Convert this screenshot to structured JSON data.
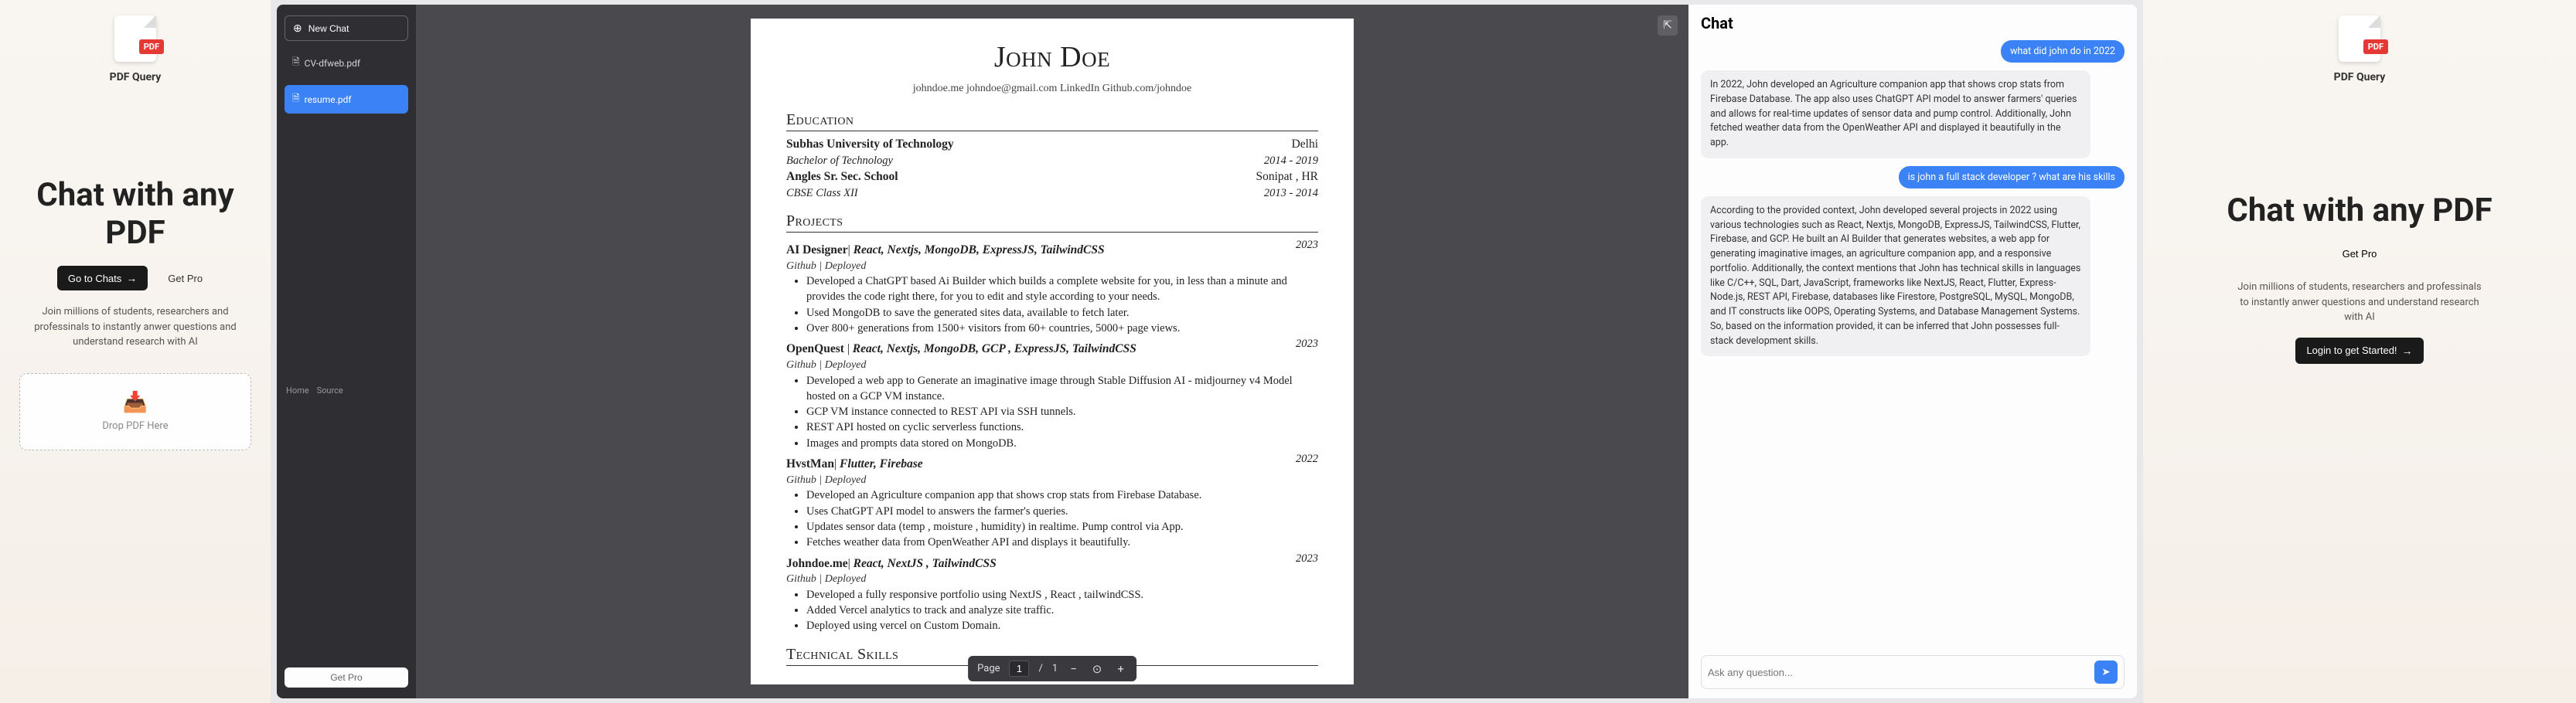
{
  "left": {
    "app_name": "PDF Query",
    "headline": "Chat with any PDF",
    "go_to_chats": "Go to Chats",
    "get_pro": "Get Pro",
    "subtext": "Join millions of students, researchers and professinals to instantly anwer questions and understand research with AI",
    "dropzone_text": "Drop PDF Here"
  },
  "app": {
    "sidebar": {
      "new_chat": "New Chat",
      "files": [
        "CV-dfweb.pdf",
        "resume.pdf"
      ],
      "get_pro": "Get Pro",
      "footer_home": "Home",
      "footer_source": "Source"
    },
    "resume": {
      "name": "John Doe",
      "contact": "johndoe.me johndoe@gmail.com LinkedIn Github.com/johndoe",
      "sections": {
        "education": "Education",
        "projects": "Projects",
        "technical": "Technical Skills"
      },
      "edu1": {
        "school": "Subhas University of Technology",
        "loc": "Delhi",
        "degree": "Bachelor of Technology",
        "dates": "2014 - 2019"
      },
      "edu2": {
        "school": "Angles Sr. Sec. School",
        "loc": "Sonipat , HR",
        "degree": "CBSE Class XII",
        "dates": "2013 - 2014"
      },
      "proj1": {
        "title": "AI Designer",
        "tech": "React, Nextjs, MongoDB, ExpressJS, TailwindCSS",
        "year": "2023",
        "sub": "Github | Deployed",
        "b1": "Developed a ChatGPT based Ai Builder which builds a complete website for you, in less than a minute and provides the code right there, for you to edit and style according to your needs.",
        "b2": "Used MongoDB to save the generated sites data, available to fetch later.",
        "b3": "Over 800+ generations from 1500+ visitors from 60+ countries, 5000+ page views."
      },
      "proj2": {
        "title": "OpenQuest",
        "tech": "React, Nextjs, MongoDB, GCP , ExpressJS, TailwindCSS",
        "year": "2023",
        "sub": "Github | Deployed",
        "b1": "Developed a web app to Generate an imaginative image through Stable Diffusion AI - midjourney v4 Model hosted on a GCP VM instance.",
        "b2": "GCP VM instance connected to REST API via SSH tunnels.",
        "b3": "REST API hosted on cyclic serverless functions.",
        "b4": "Images and prompts data stored on MongoDB."
      },
      "proj3": {
        "title": "HvstMan",
        "tech": "Flutter, Firebase",
        "year": "2022",
        "sub": "Github | Deployed",
        "b1": "Developed an Agriculture companion app that shows crop stats from Firebase Database.",
        "b2": "Uses ChatGPT API model to answers the farmer's queries.",
        "b3": "Updates sensor data (temp , moisture , humidity) in realtime. Pump control via App.",
        "b4": "Fetches weather data from OpenWeather API and displays it beautifully."
      },
      "proj4": {
        "title": "Johndoe.me",
        "tech": "React, NextJS , TailwindCSS",
        "year": "2023",
        "sub": "Github | Deployed",
        "b1": "Developed a fully responsive portfolio using NextJS , React , tailwindCSS.",
        "b2": "Added Vercel analytics to track and analyze site traffic.",
        "b3": "Deployed using vercel on Custom Domain."
      }
    },
    "pdf_toolbar": {
      "page_label": "Page",
      "page_current": "1",
      "page_total": "1"
    },
    "chat": {
      "title": "Chat",
      "q1": "what did john do in 2022",
      "a1": "In 2022, John developed an Agriculture companion app that shows crop stats from Firebase Database. The app also uses ChatGPT API model to answer farmers' queries and allows for real-time updates of sensor data and pump control. Additionally, John fetched weather data from the OpenWeather API and displayed it beautifully in the app.",
      "q2": "is john a full stack developer ? what are his skills",
      "a2": "According to the provided context, John developed several projects in 2022 using various technologies such as React, Nextjs, MongoDB, ExpressJS, TailwindCSS, Flutter, Firebase, and GCP. He built an AI Builder that generates websites, a web app for generating imaginative images, an agriculture companion app, and a responsive portfolio. Additionally, the context mentions that John has technical skills in languages like C/C++, SQL, Dart, JavaScript, frameworks like NextJS, React, Flutter, Express-Node.js, REST API, Firebase, databases like Firestore, PostgreSQL, MySQL, MongoDB, and IT constructs like OOPS, Operating Systems, and Database Management Systems. So, based on the information provided, it can be inferred that John possesses full-stack development skills.",
      "input_placeholder": "Ask any question..."
    }
  },
  "right": {
    "app_name": "PDF Query",
    "headline": "Chat with any PDF",
    "get_pro": "Get Pro",
    "subtext": "Join millions of students, researchers and professinals to instantly anwer questions and understand research with AI",
    "login": "Login to get Started!"
  }
}
